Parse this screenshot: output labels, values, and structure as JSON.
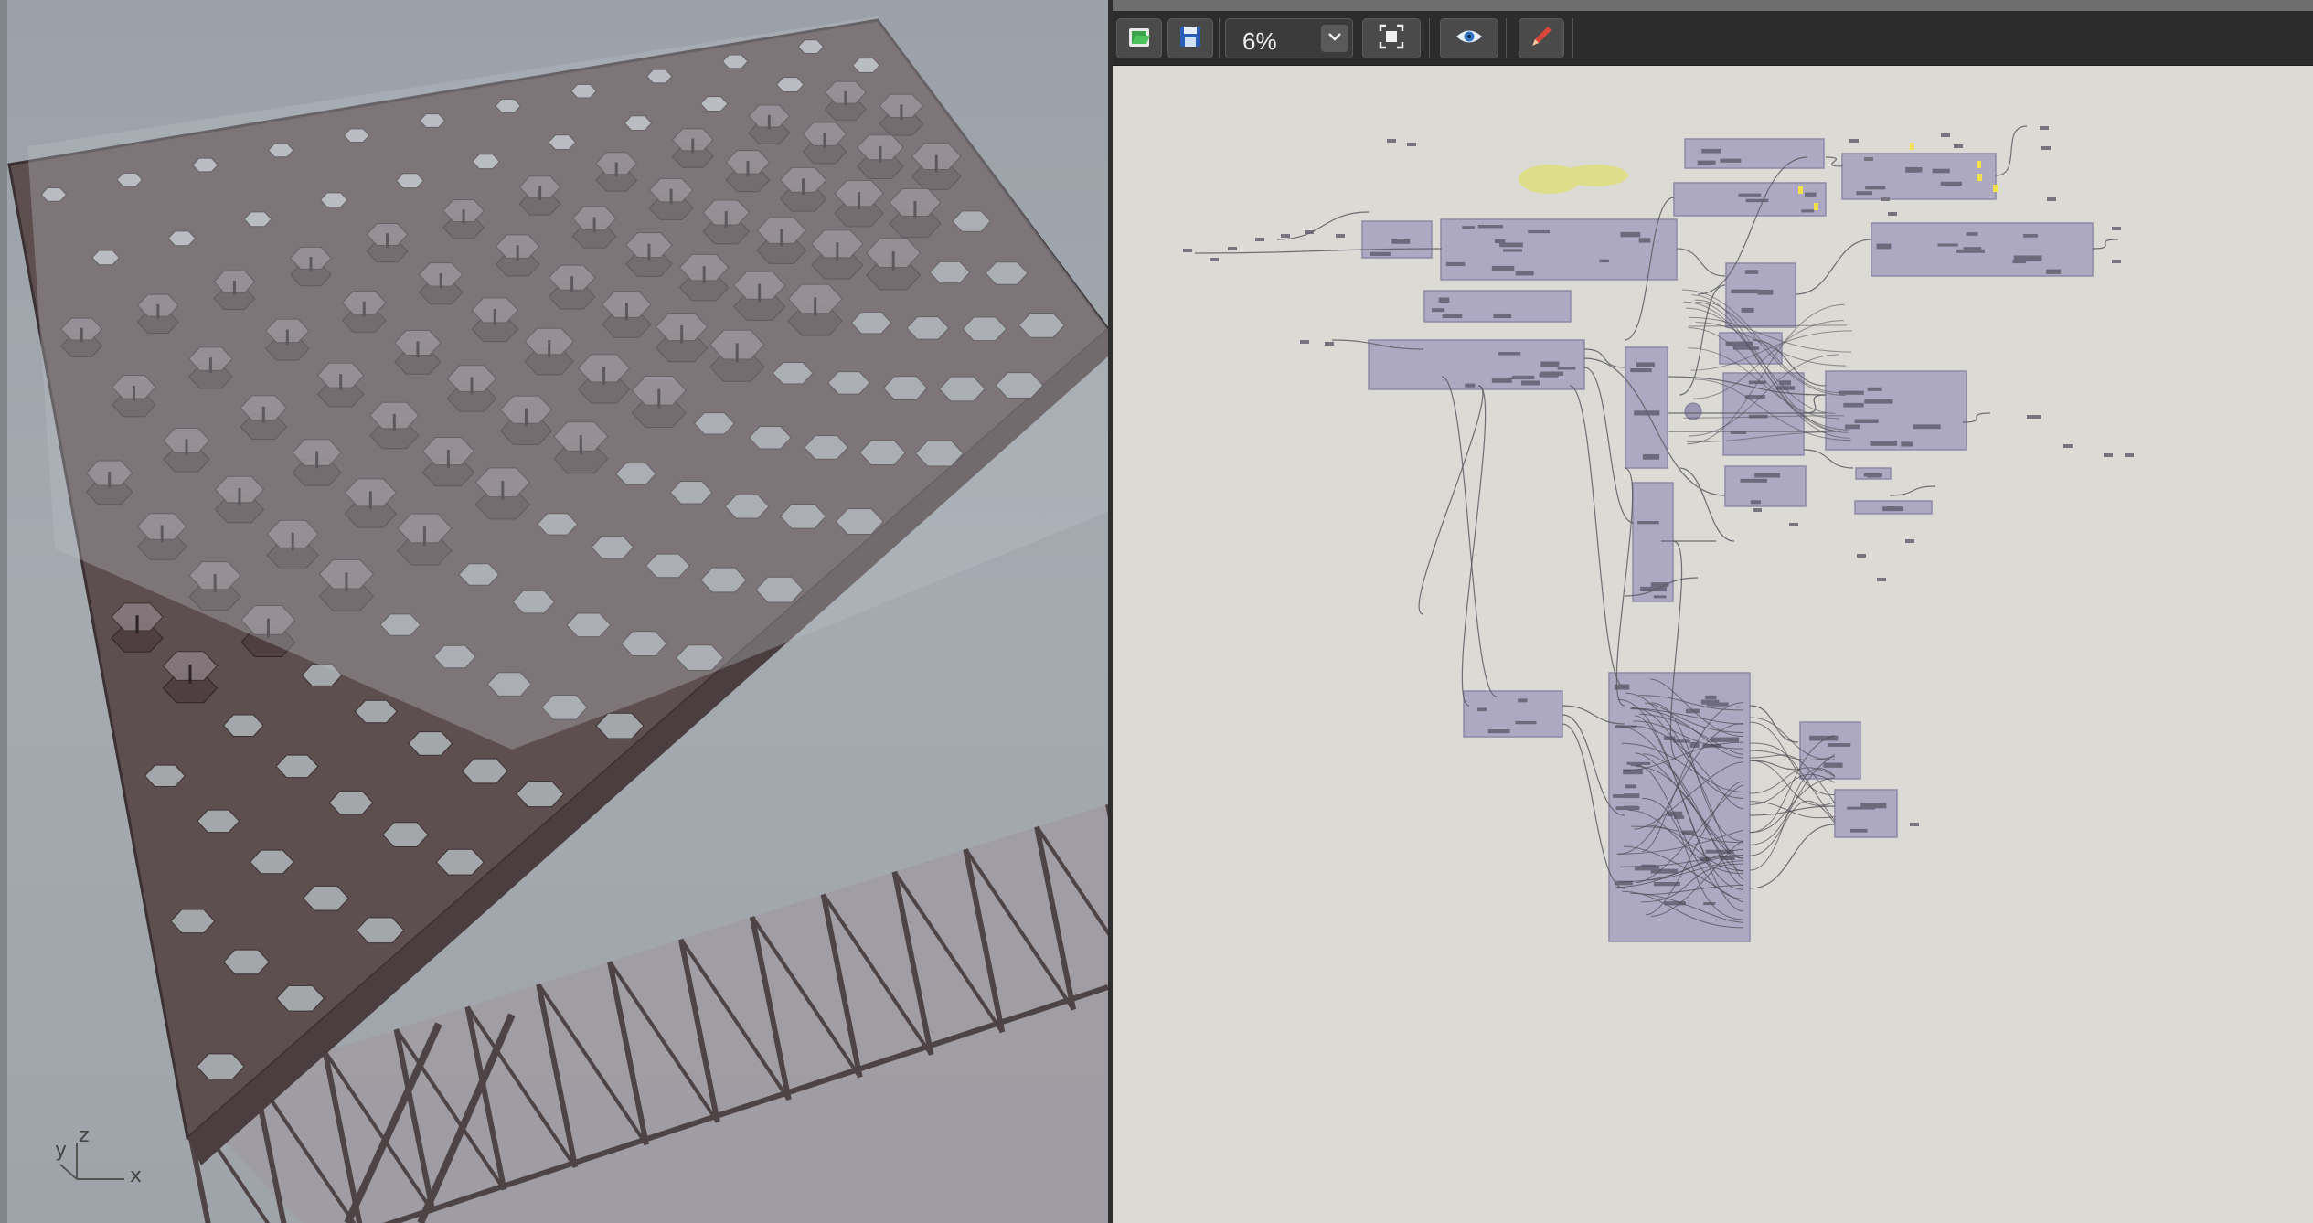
{
  "viewport": {
    "axis_labels": {
      "z": "z",
      "y": "y",
      "x": "x"
    }
  },
  "toolbar": {
    "open_icon": "folder-open-icon",
    "save_icon": "floppy-disk-icon",
    "zoom_value": "6%",
    "zoom_dropdown_icon": "chevron-down-icon",
    "fit_icon": "zoom-extents-icon",
    "preview_icon": "eye-icon",
    "sketch_icon": "pen-icon"
  },
  "colors": {
    "viewport_bg": "#a0a7ad",
    "canvas_bg": "#dcdad4",
    "group_fill": "#a7a2c0",
    "group_border": "#8d89a6",
    "note_fill": "#dede8a",
    "toolbar_bg": "#2c2c2c"
  }
}
